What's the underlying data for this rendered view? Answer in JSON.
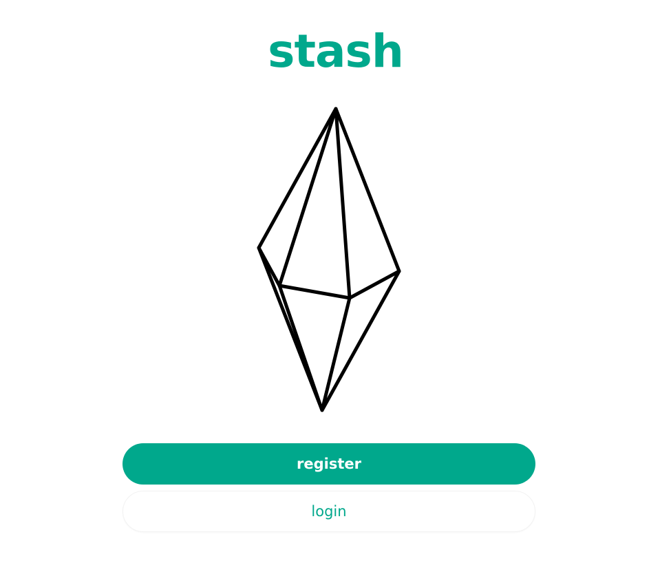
{
  "app": {
    "logo_text": "stash"
  },
  "hero": {
    "illustration_icon": "crystal-gem-icon"
  },
  "actions": {
    "register_label": "register",
    "login_label": "login"
  },
  "colors": {
    "brand": "#00a88c",
    "background": "#ffffff",
    "outline": "#000000"
  }
}
